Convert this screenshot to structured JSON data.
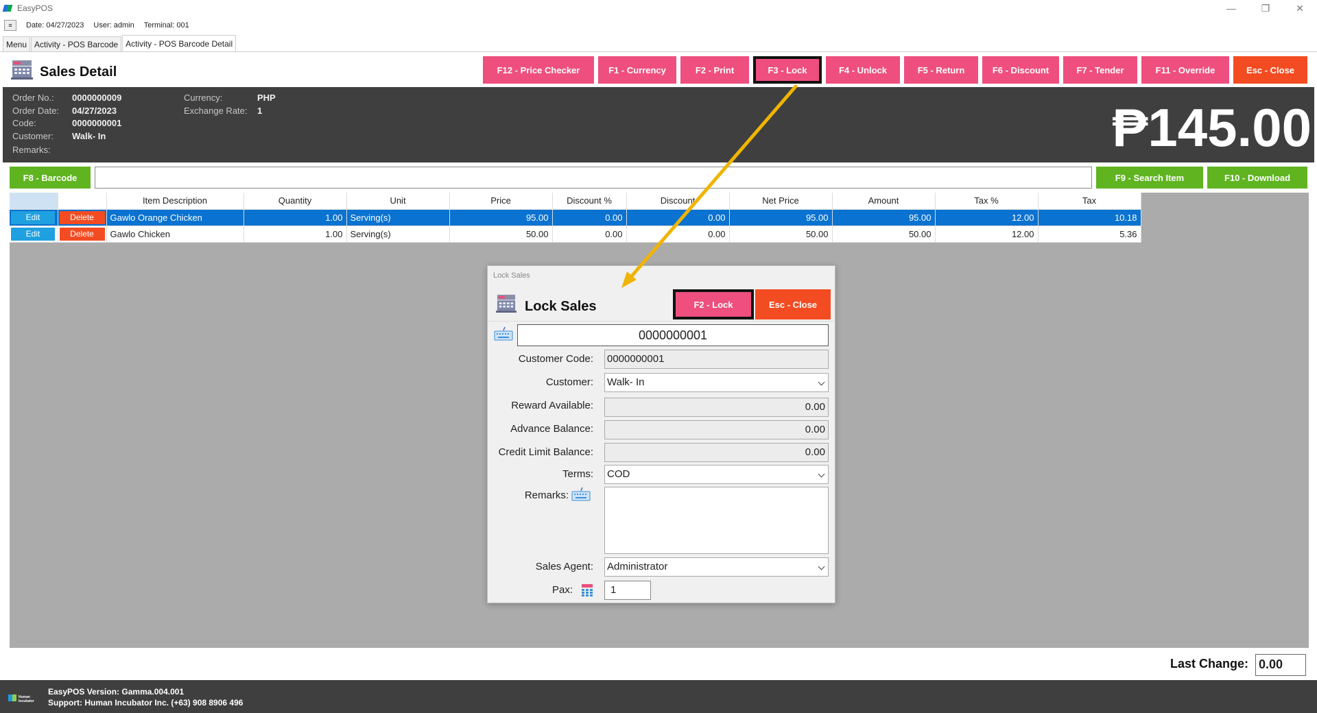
{
  "window": {
    "app_title": "EasyPOS",
    "controls": [
      "—",
      "❐",
      "✕"
    ]
  },
  "status": {
    "date": "Date: 04/27/2023",
    "user": "User: admin",
    "terminal": "Terminal: 001"
  },
  "tabs": [
    "Menu",
    "Activity - POS Barcode",
    "Activity - POS Barcode Detail"
  ],
  "header": {
    "title": "Sales Detail",
    "buttons": [
      "F12 - Price Checker",
      "F1 - Currency",
      "F2 - Print",
      "F3 - Lock",
      "F4 - Unlock",
      "F5 - Return",
      "F6 - Discount",
      "F7 - Tender",
      "F11 - Override",
      "Esc - Close"
    ]
  },
  "info": {
    "order_no_label": "Order No.:",
    "order_no": "0000000009",
    "order_date_label": "Order Date:",
    "order_date": "04/27/2023",
    "code_label": "Code:",
    "code": "0000000001",
    "customer_label": "Customer:",
    "customer": "Walk- In",
    "remarks_label": "Remarks:",
    "currency_label": "Currency:",
    "currency": "PHP",
    "exchange_label": "Exchange Rate:",
    "exchange": "1",
    "total": "₱145.00"
  },
  "barcode": {
    "barcode_btn": "F8 - Barcode",
    "search_btn": "F9 - Search Item",
    "download_btn": "F10 - Download"
  },
  "table": {
    "columns": [
      "",
      "",
      "Item Description",
      "Quantity",
      "Unit",
      "Price",
      "Discount %",
      "Discount",
      "Net Price",
      "Amount",
      "Tax %",
      "Tax"
    ],
    "edit_label": "Edit",
    "delete_label": "Delete",
    "rows": [
      {
        "description": "Gawlo Orange Chicken",
        "quantity": "1.00",
        "unit": "Serving(s)",
        "price": "95.00",
        "discount_pct": "0.00",
        "discount": "0.00",
        "net_price": "95.00",
        "amount": "95.00",
        "tax_pct": "12.00",
        "tax": "10.18"
      },
      {
        "description": "Gawlo Chicken",
        "quantity": "1.00",
        "unit": "Serving(s)",
        "price": "50.00",
        "discount_pct": "0.00",
        "discount": "0.00",
        "net_price": "50.00",
        "amount": "50.00",
        "tax_pct": "12.00",
        "tax": "5.36"
      }
    ]
  },
  "last_change": {
    "label": "Last Change:",
    "value": "0.00"
  },
  "footer": {
    "version": "EasyPOS Version: Gamma.004.001",
    "support": "Support: Human Incubator Inc. (+63) 908 8906 496",
    "logo_text": "Human Incubator"
  },
  "modal": {
    "window_title": "Lock Sales",
    "heading": "Lock Sales",
    "lock_btn": "F2 - Lock",
    "close_btn": "Esc - Close",
    "code_value": "0000000001",
    "customer_code_label": "Customer Code:",
    "customer_code": "0000000001",
    "customer_label": "Customer:",
    "customer": "Walk- In",
    "reward_label": "Reward Available:",
    "reward": "0.00",
    "advance_label": "Advance Balance:",
    "advance": "0.00",
    "credit_label": "Credit Limit Balance:",
    "credit": "0.00",
    "terms_label": "Terms:",
    "terms": "COD",
    "remarks_label": "Remarks:",
    "agent_label": "Sales Agent:",
    "agent": "Administrator",
    "pax_label": "Pax:",
    "pax": "1"
  },
  "colors": {
    "pink": "#ee4f7f",
    "orange": "#f34c22",
    "green": "#5fb420",
    "dark": "#3f3f3f",
    "selected_row": "#0a72d0",
    "arrow": "#f0b400"
  }
}
